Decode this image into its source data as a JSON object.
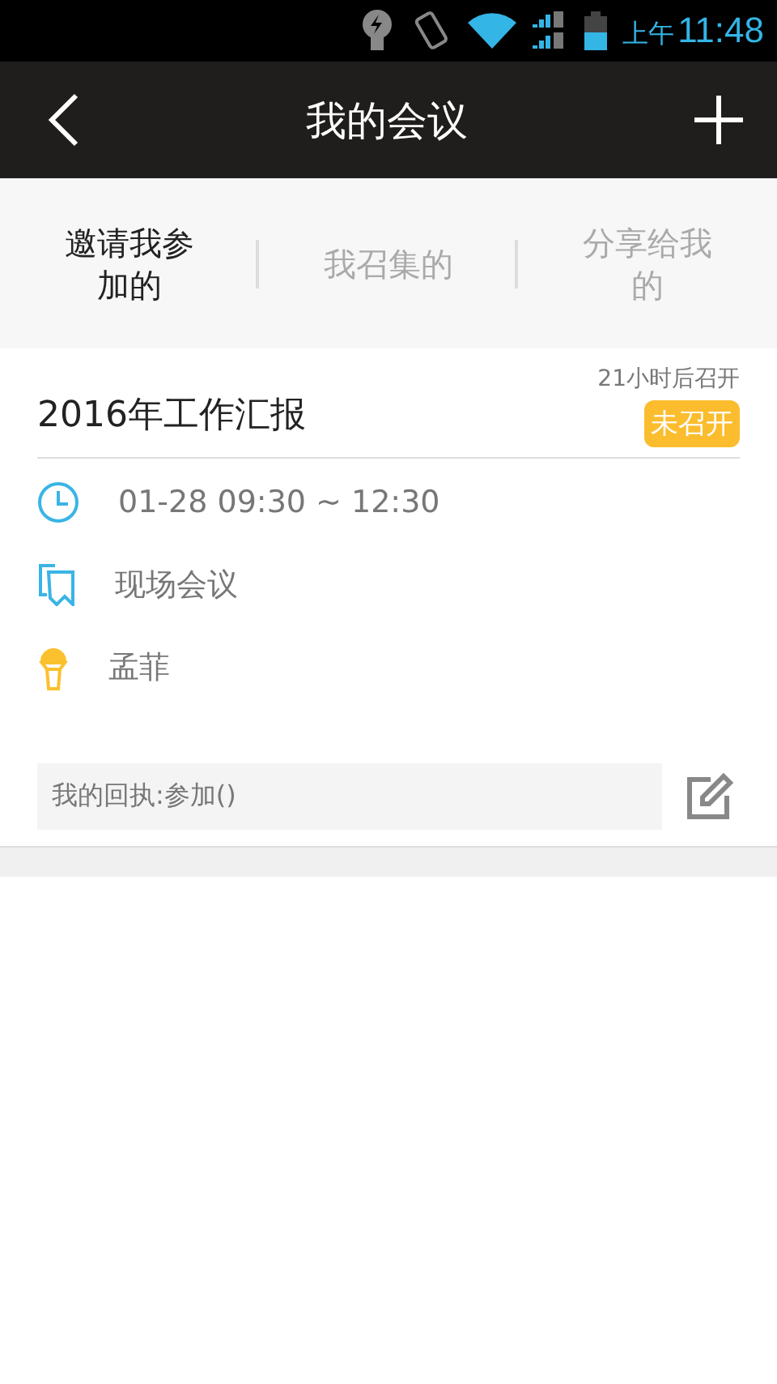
{
  "status_bar": {
    "time_prefix": "上午",
    "time": "11:48"
  },
  "header": {
    "title": "我的会议"
  },
  "tabs": [
    {
      "label": "邀请我参加的",
      "selected": true
    },
    {
      "label": "我召集的",
      "selected": false
    },
    {
      "label": "分享给我的",
      "selected": false
    }
  ],
  "meeting": {
    "title": "2016年工作汇报",
    "countdown": "21小时后召开",
    "status": "未召开",
    "details": [
      {
        "kind": "time",
        "text": "01-28 09:30 ~ 12:30"
      },
      {
        "kind": "type",
        "text": "现场会议"
      },
      {
        "kind": "host",
        "text": "孟菲"
      }
    ],
    "reply": "我的回执:参加()"
  }
}
